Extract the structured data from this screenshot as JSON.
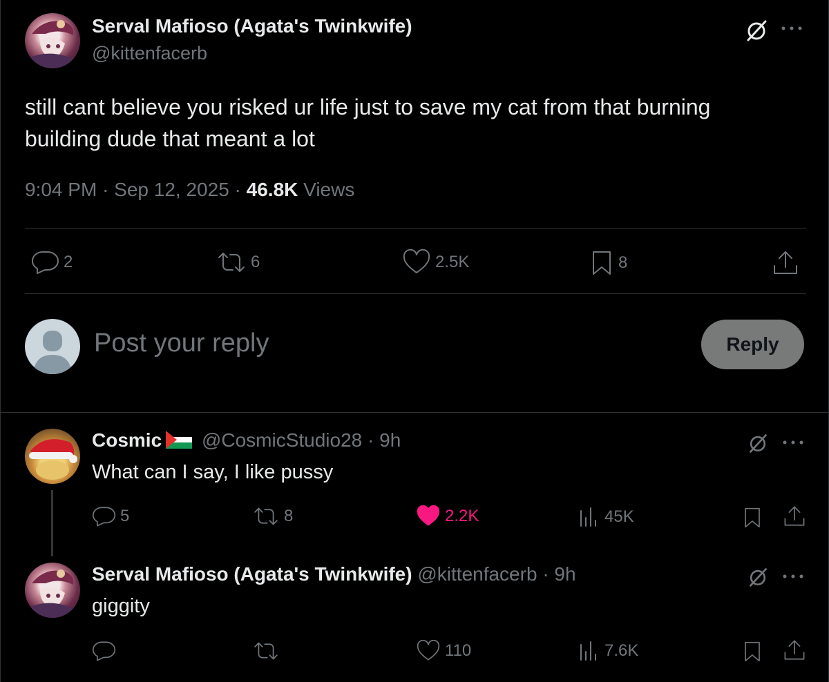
{
  "main_post": {
    "display_name": "Serval Mafioso (Agata's Twinkwife)",
    "handle": "@kittenfacerb",
    "text_line1": "still cant believe you risked ur life just to save my cat from that burning",
    "text_line2": "building dude that meant a lot",
    "time": "9:04 PM",
    "sep1": "·",
    "date": "Sep 12, 2025",
    "sep2": "·",
    "views_count": "46.8K",
    "views_label": "Views",
    "stats": {
      "replies": "2",
      "reposts": "6",
      "likes": "2.5K",
      "bookmarks": "8"
    }
  },
  "reply_composer": {
    "placeholder": "Post your reply",
    "button_label": "Reply"
  },
  "replies": [
    {
      "display_name": "Cosmic",
      "handle": "@CosmicStudio28",
      "sep": "·",
      "age": "9h",
      "text": "What can I say, I like pussy",
      "stats": {
        "replies": "5",
        "reposts": "8",
        "likes": "2.2K",
        "views": "45K"
      },
      "liked": true
    },
    {
      "display_name": "Serval Mafioso (Agata's Twinkwife)",
      "handle": "@kittenfacerb",
      "sep": "·",
      "age": "9h",
      "text": "giggity",
      "stats": {
        "replies": "",
        "reposts": "",
        "likes": "110",
        "views": "7.6K"
      },
      "liked": false
    }
  ],
  "icons": {
    "more": "more-icon",
    "grok": "grok-icon",
    "reply": "reply-icon",
    "repost": "repost-icon",
    "like": "heart-icon",
    "bookmark": "bookmark-icon",
    "share": "share-icon",
    "views": "views-icon"
  },
  "colors": {
    "background": "#000000",
    "text": "#e7e9ea",
    "muted": "#71767b",
    "like_active": "#f91880",
    "divider": "#2f3336"
  }
}
